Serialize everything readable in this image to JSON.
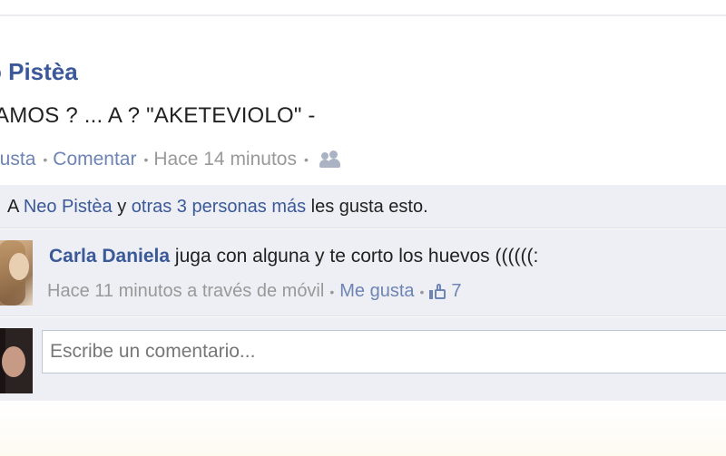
{
  "post": {
    "author": "o Pistèa",
    "status": "AMOS ? ... A ? \"AKETEVIOLO\" -",
    "actions": {
      "like": "gusta",
      "comment": "Comentar",
      "time": "Hace 14 minutos"
    },
    "icons": {
      "audience": "friends-audience-icon"
    }
  },
  "likes": {
    "prefix": "A",
    "person": "Neo Pistèa",
    "connector": "y",
    "others": "otras 3 personas más",
    "suffix": "les gusta esto."
  },
  "comment": {
    "author": "Carla Daniela",
    "text": "juga con alguna y te corto los huevos ((((((:",
    "meta": "Hace 11 minutos a través de móvil",
    "like_link": "Me gusta",
    "like_count": "7",
    "icon": "thumbs-up-icon"
  },
  "reply": {
    "placeholder": "Escribe un comentario..."
  },
  "colors": {
    "link": "#3b5998",
    "link_light": "#6d84b4",
    "panel": "#edeff4",
    "muted": "#999999"
  }
}
